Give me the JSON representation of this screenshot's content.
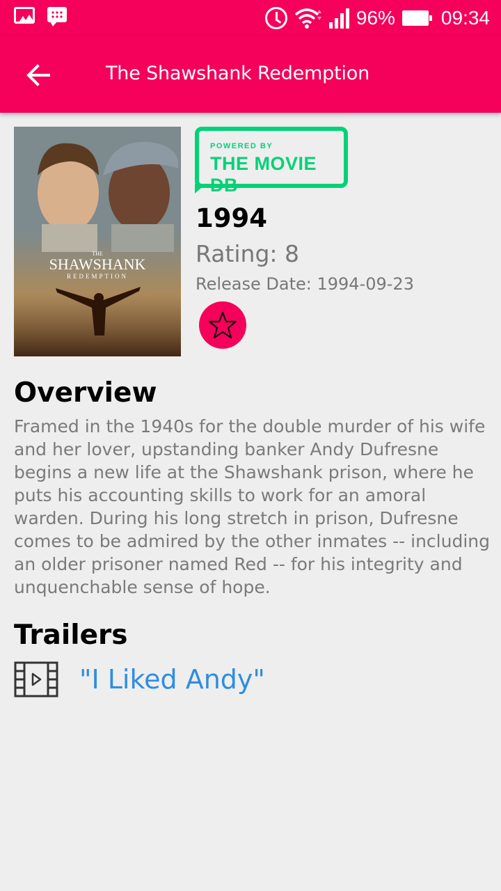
{
  "status_bar": {
    "battery": "96%",
    "time": "09:34",
    "left_icons": [
      "gallery-icon",
      "chat-icon"
    ],
    "right_icons": [
      "alarm-icon",
      "wifi-icon",
      "signal-icon",
      "battery-icon"
    ]
  },
  "toolbar": {
    "title": "The Shawshank Redemption",
    "back_icon": "arrow-back-icon"
  },
  "poster": {
    "title": "SHAWSHANK",
    "subtitle": "REDEMPTION",
    "prefix": "THE"
  },
  "badge": {
    "small": "POWERED BY",
    "big": "THE MOVIE DB"
  },
  "movie": {
    "year": "1994",
    "rating": "Rating: 8",
    "release_date": "Release Date: 1994-09-23",
    "favorite_icon": "star-outline-icon"
  },
  "overview": {
    "title": "Overview",
    "text": "Framed in the 1940s for the double murder of his wife and her lover, upstanding banker Andy Dufresne begins a new life at the Shawshank prison, where he puts his accounting skills to work for an amoral warden. During his long stretch in prison, Dufresne comes to be admired by the other inmates -- including an older prisoner named Red -- for his integrity and unquenchable sense of hope."
  },
  "trailers": {
    "title": "Trailers",
    "items": [
      {
        "label": "\"I Liked Andy\"",
        "icon": "film-play-icon"
      }
    ]
  },
  "colors": {
    "accent": "#f5005a",
    "tmdb_green": "#01d277",
    "link_blue": "#2d8ee0",
    "body_text": "#777777",
    "background": "#eeeeee"
  }
}
